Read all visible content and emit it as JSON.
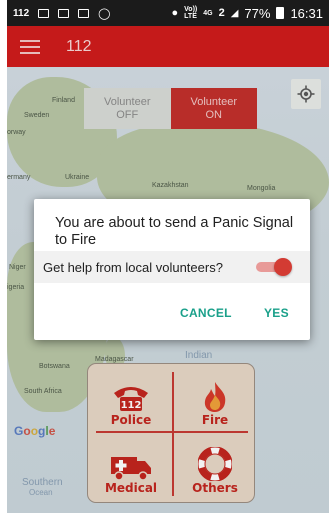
{
  "status_bar": {
    "notif_label": "112",
    "network_volte": "Vo))\nLTE",
    "network_4g": "4G",
    "sim_slot": "2",
    "battery_percent": "77%",
    "time": "16:31"
  },
  "app_bar": {
    "title": "112",
    "background_color": "#d01c1c"
  },
  "map": {
    "labels": {
      "finland": "Finland",
      "sweden": "Sweden",
      "norway": "orway",
      "ukraine": "Ukraine",
      "germany": "ermany",
      "kazakhstan": "Kazakhstan",
      "mongolia": "Mongolia",
      "niger": "Niger",
      "nigeria": "igeria",
      "madagascar": "Madagascar",
      "botswana": "Botswana",
      "south_africa": "South Africa",
      "indian": "Indian",
      "southern": "Southern",
      "ocean_partial": "Ocean"
    },
    "google_logo": "Google"
  },
  "volunteer_toggle": {
    "off_label": "Volunteer\nOFF",
    "on_label": "Volunteer\nON",
    "selected": "ON"
  },
  "emergency_panel": {
    "police": "Police",
    "fire": "Fire",
    "medical": "Medical",
    "others": "Others",
    "police_badge": "112"
  },
  "dialog": {
    "title": "You are about to send a Panic Signal to Fire",
    "volunteer_question": "Get help from local volunteers?",
    "volunteer_switch_on": true,
    "cancel_label": "CANCEL",
    "yes_label": "YES",
    "accent_color": "#1aa08a"
  }
}
